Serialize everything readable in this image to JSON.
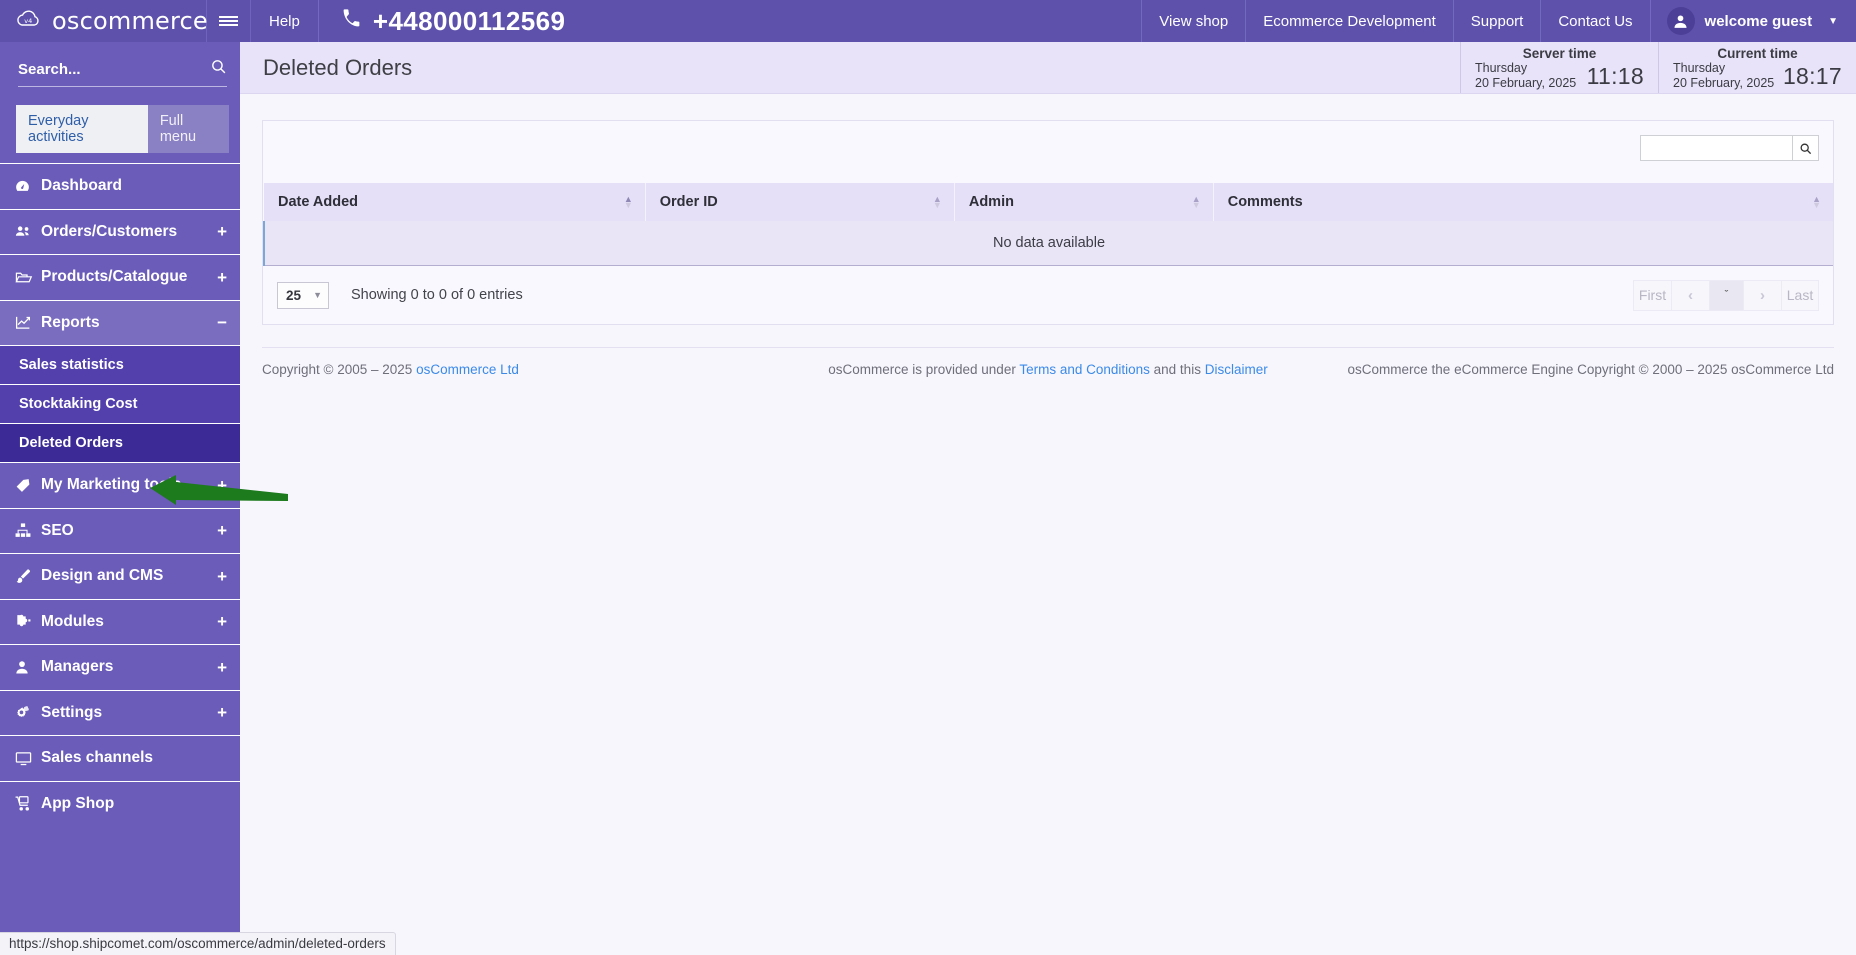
{
  "topbar": {
    "brand": "oscommerce",
    "brand_badge": "v4",
    "hamburger_icon": "hamburger-menu-icon",
    "help_label": "Help",
    "phone": "+448000112569",
    "phone_icon": "phone-icon",
    "nav_items": [
      {
        "label": "View shop"
      },
      {
        "label": "Ecommerce Development"
      },
      {
        "label": "Support"
      },
      {
        "label": "Contact Us"
      }
    ],
    "user": {
      "name": "welcome guest",
      "avatar_icon": "user-avatar-icon",
      "caret_icon": "chevron-down-icon"
    },
    "bg_color": "#5d51ab"
  },
  "sidebar": {
    "search_placeholder": "Search...",
    "search_value": "",
    "search_icon": "search-icon",
    "tabs": [
      {
        "label": "Everyday activities",
        "active": true
      },
      {
        "label": "Full menu",
        "active": false
      }
    ],
    "items": [
      {
        "label": "Dashboard",
        "icon": "dashboard-gauge-icon",
        "toggle": ""
      },
      {
        "label": "Orders/Customers",
        "icon": "users-group-icon",
        "toggle": "+"
      },
      {
        "label": "Products/Catalogue",
        "icon": "folder-open-icon",
        "toggle": "+"
      },
      {
        "label": "Reports",
        "icon": "chart-line-icon",
        "toggle": "−",
        "expanded": true
      },
      {
        "label": "My Marketing tools",
        "icon": "tags-icon",
        "toggle": "+"
      },
      {
        "label": "SEO",
        "icon": "sitemap-icon",
        "toggle": "+"
      },
      {
        "label": "Design and CMS",
        "icon": "paint-brush-icon",
        "toggle": "+"
      },
      {
        "label": "Modules",
        "icon": "puzzle-piece-icon",
        "toggle": "+"
      },
      {
        "label": "Managers",
        "icon": "user-icon",
        "toggle": "+"
      },
      {
        "label": "Settings",
        "icon": "gears-icon",
        "toggle": "+"
      },
      {
        "label": "Sales channels",
        "icon": "desktop-monitor-icon",
        "toggle": ""
      },
      {
        "label": "App Shop",
        "icon": "shopping-cart-icon",
        "toggle": ""
      }
    ],
    "submenu": [
      {
        "label": "Sales statistics",
        "active": false
      },
      {
        "label": "Stocktaking Cost",
        "active": false
      },
      {
        "label": "Deleted Orders",
        "active": true
      }
    ],
    "bg_color": "#6a5cb8"
  },
  "page": {
    "title": "Deleted Orders",
    "server_time": {
      "title": "Server time",
      "day": "Thursday",
      "date": "20 February, 2025",
      "clock": "11:18"
    },
    "current_time": {
      "title": "Current time",
      "day": "Thursday",
      "date": "20 February, 2025",
      "clock": "18:17"
    }
  },
  "table": {
    "search_value": "",
    "search_icon": "search-icon",
    "columns": [
      {
        "label": "Date Added",
        "sort": "asc"
      },
      {
        "label": "Order ID",
        "sort": "none"
      },
      {
        "label": "Admin",
        "sort": "none"
      },
      {
        "label": "Comments",
        "sort": "none"
      }
    ],
    "rows": [],
    "empty_message": "No data available"
  },
  "pagination": {
    "page_length": "25",
    "page_length_caret": "chevron-down-icon",
    "showing": "Showing 0 to 0 of 0 entries",
    "buttons": [
      {
        "label": "First",
        "name": "first"
      },
      {
        "label": "‹",
        "name": "previous"
      },
      {
        "label": "ˇ",
        "name": "current-page"
      },
      {
        "label": "›",
        "name": "next"
      },
      {
        "label": "Last",
        "name": "last"
      }
    ]
  },
  "footer": {
    "copyright_pre": "Copyright © 2005 – 2025 ",
    "copyright_link": "osCommerce Ltd",
    "middle_pre": "osCommerce is provided under ",
    "middle_link1": "Terms and Conditions",
    "middle_mid": " and this ",
    "middle_link2": "Disclaimer",
    "right": "osCommerce the eCommerce Engine Copyright © 2000 – 2025 osCommerce Ltd"
  },
  "statusbar": {
    "url": "https://shop.shipcomet.com/oscommerce/admin/deleted-orders"
  },
  "annotation": {
    "arrow_color": "#1d7a1d",
    "target": "Deleted Orders"
  }
}
